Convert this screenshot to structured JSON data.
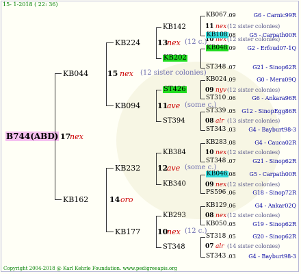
{
  "date": "15- 1-2018 ( 22: 36)",
  "copyright": "Copyright 2004-2018 @ Karl Kehrle Foundation.   www.pedigreeapis.org",
  "root": {
    "name": "B744(ABD)",
    "num": "17",
    "mark": "nex"
  },
  "g1": [
    {
      "name": "KB044",
      "num": "15",
      "mark": "nex",
      "note": "(12 sister colonies)"
    },
    {
      "name": "KB162",
      "num": "14",
      "mark": "oro"
    }
  ],
  "g2": [
    {
      "name": "KB224",
      "num": "13",
      "mark": "nex",
      "note": "(12 c.)"
    },
    {
      "name": "KB094",
      "num": "11",
      "mark": "ave",
      "note": "(some c.)"
    },
    {
      "name": "KB232",
      "num": "12",
      "mark": "ave",
      "note": "(some c.)"
    },
    {
      "name": "KB177",
      "num": "10",
      "mark": "nex",
      "note": "(12 c.)"
    }
  ],
  "g3": [
    {
      "name": "KB142",
      "num": "11",
      "mark": "nex",
      "note": "(12 sister colonies)"
    },
    {
      "name": "KB202",
      "num": "10",
      "mark": "nex",
      "note": "(12 sister colonies)"
    },
    {
      "name": "ST426",
      "num": "09",
      "mark": "nyv",
      "note": "(12 sister colonies)"
    },
    {
      "name": "ST394",
      "num": "08",
      "mark": "alr",
      "note": "(13 sister colonies)"
    },
    {
      "name": "KB384",
      "num": "10",
      "mark": "nex",
      "note": "(12 sister colonies)"
    },
    {
      "name": "KB340",
      "num": "09",
      "mark": "nex",
      "note": "(12 sister colonies)"
    },
    {
      "name": "KB293",
      "num": "08",
      "mark": "nex",
      "note": "(12 sister colonies)"
    },
    {
      "name": "ST348",
      "num": "07",
      "mark": "alr",
      "note": "(14 sister colonies)"
    }
  ],
  "g4": [
    {
      "name": "KB067",
      "yr": ".09",
      "q": "G6 - Carnic99R"
    },
    {
      "name": "KB108",
      "yr": ".08",
      "q": "G5 - Carpath00R"
    },
    {
      "name": "KB048",
      "yr": ".09",
      "q": "G2 - Erfoud07-1Q"
    },
    {
      "name": "ST348",
      "yr": ".07",
      "q": "G21 - Sinop62R"
    },
    {
      "name": "KB024",
      "yr": ".09",
      "q": "G0 - Meru09Q"
    },
    {
      "name": "ST310",
      "yr": ".06",
      "q": "G6 - Ankara96R"
    },
    {
      "name": "ST339",
      "yr": ".05",
      "q": "G12 - SinopEgg86R"
    },
    {
      "name": "ST343",
      "yr": ".03",
      "q": "G4 - Bayburt98-3"
    },
    {
      "name": "KB283",
      "yr": ".08",
      "q": "G4 - Cauca02R"
    },
    {
      "name": "ST348",
      "yr": ".07",
      "q": "G21 - Sinop62R"
    },
    {
      "name": "KB046",
      "yr": ".08",
      "q": "G5 - Carpath00R"
    },
    {
      "name": "PS596",
      "yr": ".06",
      "q": "G18 - Sinop72R"
    },
    {
      "name": "KB129",
      "yr": ".06",
      "q": "G4 - Ankar02Q"
    },
    {
      "name": "KB050",
      "yr": ".05",
      "q": "G19 - Sinop62R"
    },
    {
      "name": "ST318",
      "yr": ".05",
      "q": "G20 - Sinop62R"
    },
    {
      "name": "ST343",
      "yr": ".03",
      "q": "G4 - Bayburt98-3"
    }
  ]
}
